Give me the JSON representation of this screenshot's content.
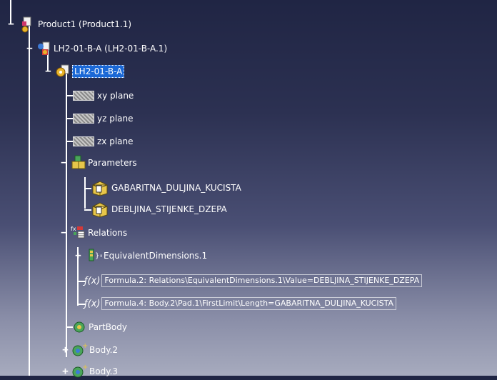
{
  "tree": {
    "product": "Product1 (Product1.1)",
    "component": "LH2-01-B-A (LH2-01-B-A.1)",
    "part": "LH2-01-B-A",
    "planes": [
      "xy plane",
      "yz plane",
      "zx plane"
    ],
    "parameters_label": "Parameters",
    "parameters": [
      "GABARITNA_DULJINA_KUCISTA",
      "DEBLJINA_STIJENKE_DZEPA"
    ],
    "relations_label": "Relations",
    "equivalent_dimensions": "EquivalentDimensions.1",
    "formulas": [
      "Formula.2: Relations\\EquivalentDimensions.1\\Value=DEBLJINA_STIJENKE_DZEPA",
      "Formula.4: Body.2\\Pad.1\\FirstLimit\\Length=GABARITNA_DULJINA_KUCISTA"
    ],
    "bodies": [
      "PartBody",
      "Body.2",
      "Body.3"
    ]
  },
  "colors": {
    "background_top": "#202544",
    "background_bottom": "#a7abbe",
    "selection": "#1b68d6"
  }
}
